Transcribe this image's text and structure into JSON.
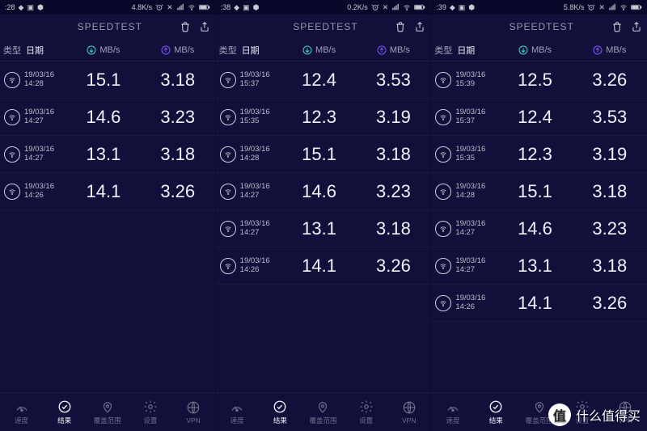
{
  "panels": [
    {
      "status": {
        "time": ":28",
        "netspeed": "4.8K/s"
      },
      "rows": [
        {
          "date": "19/03/16",
          "time": "14:28",
          "dl": "15.1",
          "ul": "3.18"
        },
        {
          "date": "19/03/16",
          "time": "14:27",
          "dl": "14.6",
          "ul": "3.23"
        },
        {
          "date": "19/03/16",
          "time": "14:27",
          "dl": "13.1",
          "ul": "3.18"
        },
        {
          "date": "19/03/16",
          "time": "14:26",
          "dl": "14.1",
          "ul": "3.26"
        }
      ]
    },
    {
      "status": {
        "time": ":38",
        "netspeed": "0.2K/s"
      },
      "rows": [
        {
          "date": "19/03/16",
          "time": "15:37",
          "dl": "12.4",
          "ul": "3.53"
        },
        {
          "date": "19/03/16",
          "time": "15:35",
          "dl": "12.3",
          "ul": "3.19"
        },
        {
          "date": "19/03/16",
          "time": "14:28",
          "dl": "15.1",
          "ul": "3.18"
        },
        {
          "date": "19/03/16",
          "time": "14:27",
          "dl": "14.6",
          "ul": "3.23"
        },
        {
          "date": "19/03/16",
          "time": "14:27",
          "dl": "13.1",
          "ul": "3.18"
        },
        {
          "date": "19/03/16",
          "time": "14:26",
          "dl": "14.1",
          "ul": "3.26"
        }
      ]
    },
    {
      "status": {
        "time": ":39",
        "netspeed": "5.8K/s"
      },
      "rows": [
        {
          "date": "19/03/16",
          "time": "15:39",
          "dl": "12.5",
          "ul": "3.26"
        },
        {
          "date": "19/03/16",
          "time": "15:37",
          "dl": "12.4",
          "ul": "3.53"
        },
        {
          "date": "19/03/16",
          "time": "15:35",
          "dl": "12.3",
          "ul": "3.19"
        },
        {
          "date": "19/03/16",
          "time": "14:28",
          "dl": "15.1",
          "ul": "3.18"
        },
        {
          "date": "19/03/16",
          "time": "14:27",
          "dl": "14.6",
          "ul": "3.23"
        },
        {
          "date": "19/03/16",
          "time": "14:27",
          "dl": "13.1",
          "ul": "3.18"
        },
        {
          "date": "19/03/16",
          "time": "14:26",
          "dl": "14.1",
          "ul": "3.26"
        }
      ]
    }
  ],
  "brand": "SPEEDTEST",
  "colhead": {
    "type": "类型",
    "date": "日期",
    "unit": "MB/s"
  },
  "nav": {
    "speed": "速度",
    "results": "结果",
    "coverage": "覆盖范围",
    "settings": "设置",
    "vpn": "VPN"
  },
  "watermark": {
    "badge": "值",
    "text": "什么值得买"
  }
}
